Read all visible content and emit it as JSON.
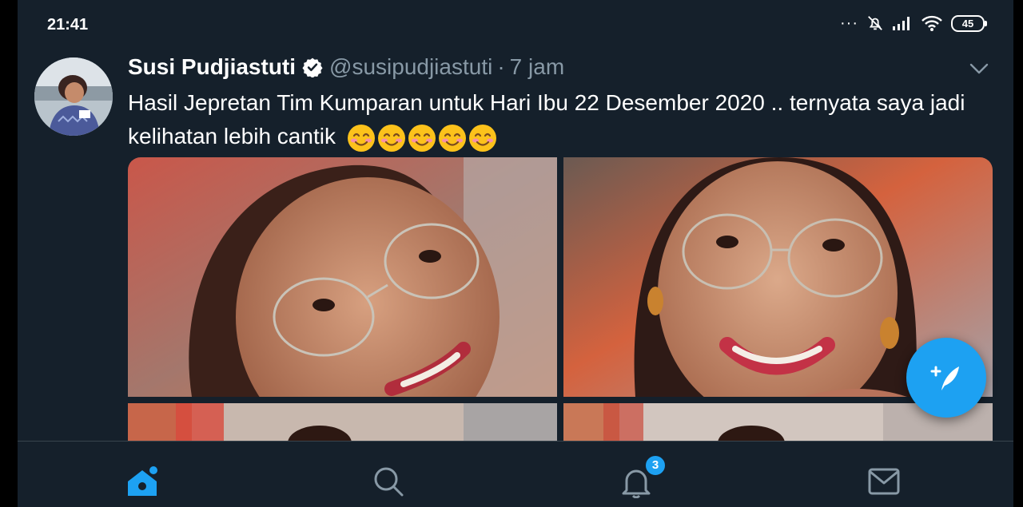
{
  "status_bar": {
    "time": "21:41",
    "battery": "45",
    "icons": [
      "more-dots-icon",
      "mute-bell-icon",
      "signal-icon",
      "wifi-icon",
      "battery-icon"
    ]
  },
  "tweet": {
    "author_name": "Susi Pudjiastuti",
    "handle": "@susipudjiastuti",
    "separator": "·",
    "time": "7 jam",
    "verified": true,
    "text": "Hasil Jepretan Tim Kumparan untuk Hari Ibu 22 Desember 2020 .. ternyata saya jadi kelihatan lebih cantik",
    "emoji_count": 5,
    "media_count": 4
  },
  "bottom_nav": {
    "items": [
      "home-icon",
      "search-icon",
      "notifications-icon",
      "messages-icon"
    ],
    "notification_badge": "3"
  },
  "colors": {
    "background": "#15202b",
    "accent": "#1da1f2",
    "secondary_text": "#8899a6",
    "divider": "#38444d"
  }
}
